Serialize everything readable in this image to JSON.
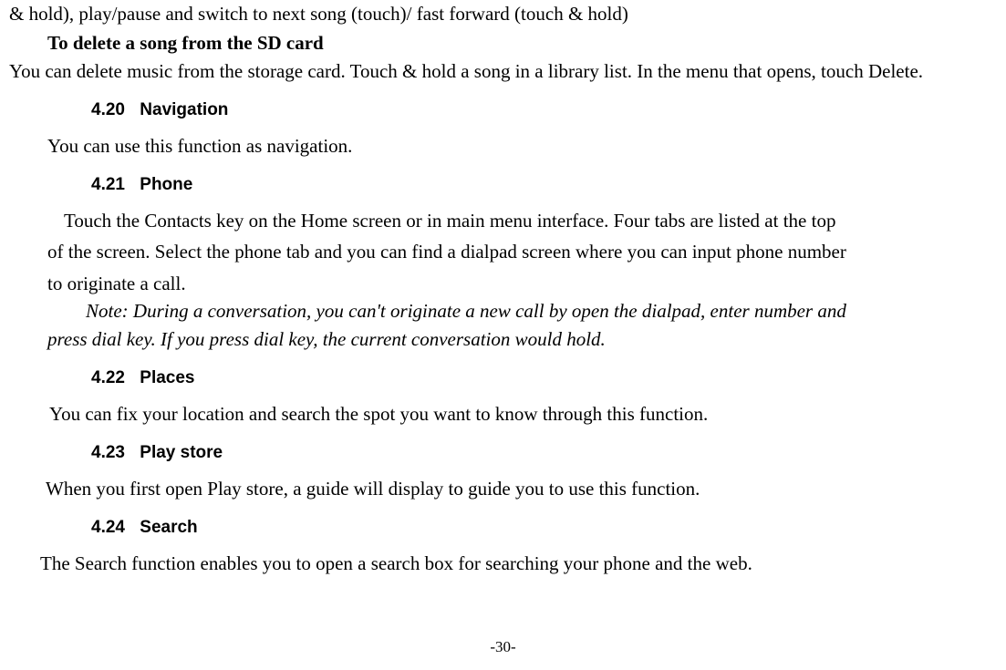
{
  "fragment_line": "& hold), play/pause and switch to next song (touch)/ fast forward (touch & hold)",
  "delete_heading": "To delete a song from the SD card",
  "delete_body": "  You can delete music from the storage card. Touch & hold a song in a library list. In the menu that opens, touch Delete.",
  "sections": {
    "navigation": {
      "number": "4.20",
      "title": "Navigation",
      "body": "You can use this function as navigation."
    },
    "phone": {
      "number": "4.21",
      "title": "Phone",
      "body_lines": [
        "Touch the Contacts key on the Home screen or in main menu interface. Four tabs are listed at the top",
        "of the screen. Select the phone tab and you can find a dialpad screen where you can input phone number",
        "to originate a call."
      ],
      "note_lines": [
        "Note: During a conversation, you can't originate a new call by open the dialpad, enter number and",
        "press dial key. If you press dial key, the current conversation would hold."
      ]
    },
    "places": {
      "number": "4.22",
      "title": "Places",
      "body": "You can fix your location and search the spot you want to know through this function."
    },
    "playstore": {
      "number": "4.23",
      "title": "Play store",
      "body": "When you first open Play store, a guide will display to guide you to use this function."
    },
    "search": {
      "number": "4.24",
      "title": "Search",
      "body": "The Search function enables you to open a search box for searching your phone and the web."
    }
  },
  "page_number": "-30-"
}
